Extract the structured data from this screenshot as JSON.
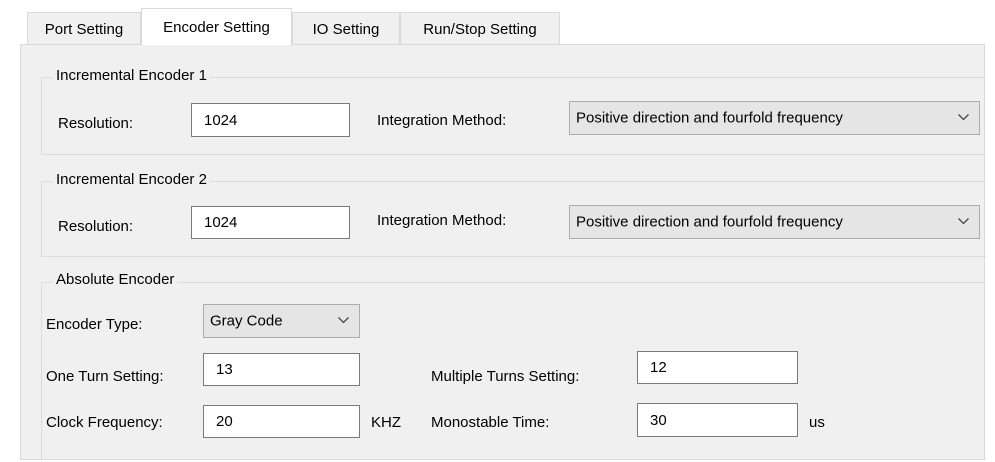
{
  "tabs": [
    {
      "label": "Port Setting",
      "active": false
    },
    {
      "label": "Encoder Setting",
      "active": true
    },
    {
      "label": "IO Setting",
      "active": false
    },
    {
      "label": "Run/Stop Setting",
      "active": false
    }
  ],
  "incremental_1": {
    "title": "Incremental Encoder 1",
    "resolution_label": "Resolution:",
    "resolution_value": "1024",
    "method_label": "Integration Method:",
    "method_value": "Positive direction and fourfold frequency"
  },
  "incremental_2": {
    "title": "Incremental Encoder 2",
    "resolution_label": "Resolution:",
    "resolution_value": "1024",
    "method_label": "Integration Method:",
    "method_value": "Positive direction and fourfold frequency"
  },
  "absolute": {
    "title": "Absolute Encoder",
    "type_label": "Encoder Type:",
    "type_value": "Gray Code",
    "one_turn_label": "One Turn Setting:",
    "one_turn_value": "13",
    "multi_turn_label": "Multiple Turns Setting:",
    "multi_turn_value": "12",
    "clock_label": "Clock Frequency:",
    "clock_value": "20",
    "clock_unit": "KHZ",
    "mono_label": "Monostable Time:",
    "mono_value": "30",
    "mono_unit": "us"
  },
  "colors": {
    "panel_bg": "#f0f0f0",
    "border": "#d9d9d9",
    "input_border": "#7a7a7a",
    "combo_bg": "#e5e5e5"
  },
  "icons": {
    "dropdown": "chevron-down-icon"
  }
}
